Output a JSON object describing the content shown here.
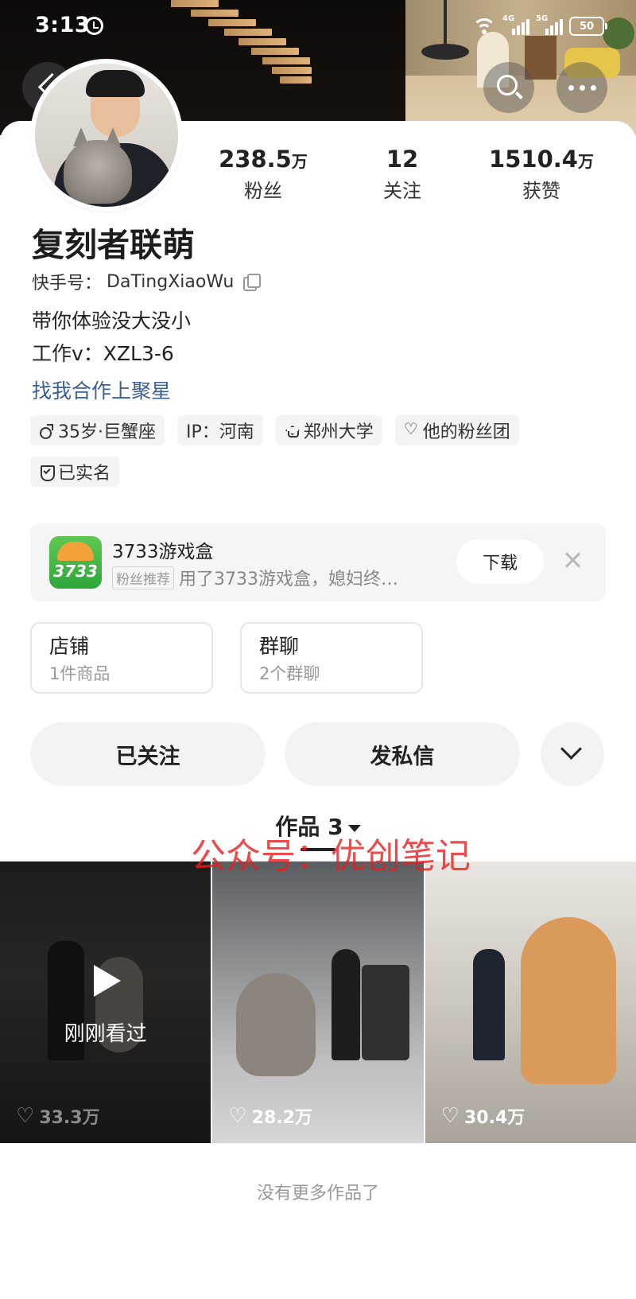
{
  "status_bar": {
    "time": "3:13",
    "net1": "4G",
    "net2": "5G",
    "battery": "50"
  },
  "header": {
    "icons": [
      "back-icon",
      "search-icon",
      "more-icon"
    ]
  },
  "profile": {
    "nickname": "复刻者联萌",
    "account_label": "快手号：",
    "account_id": "DaTingXiaoWu",
    "bio_line1": "带你体验没大没小",
    "bio_line2": "工作v：XZL3-6",
    "cooperation_link": "找我合作上聚星",
    "stats": [
      {
        "num": "238.5",
        "unit": "万",
        "label": "粉丝"
      },
      {
        "num": "12",
        "unit": "",
        "label": "关注"
      },
      {
        "num": "1510.4",
        "unit": "万",
        "label": "获赞"
      }
    ],
    "tags": [
      {
        "icon": "male-icon",
        "text": "35岁·巨蟹座"
      },
      {
        "icon": "",
        "text": "IP：河南"
      },
      {
        "icon": "cap-icon",
        "text": "郑州大学"
      },
      {
        "icon": "heart-icon",
        "text": "他的粉丝团"
      },
      {
        "icon": "shield-icon",
        "text": "已实名"
      }
    ]
  },
  "ad": {
    "logo_text": "3733",
    "title": "3733游戏盒",
    "badge": "粉丝推荐",
    "desc": "用了3733游戏盒，媳妇终…",
    "download": "下载"
  },
  "cards": [
    {
      "title": "店铺",
      "sub": "1件商品"
    },
    {
      "title": "群聊",
      "sub": "2个群聊"
    }
  ],
  "actions": {
    "follow": "已关注",
    "message": "发私信"
  },
  "works": {
    "tab_label": "作品 3",
    "items": [
      {
        "likes": "33.3万",
        "overlay": "刚刚看过"
      },
      {
        "likes": "28.2万",
        "overlay": ""
      },
      {
        "likes": "30.4万",
        "overlay": ""
      }
    ],
    "watermark": "公众号：优创笔记",
    "no_more": "没有更多作品了"
  },
  "colors": {
    "link": "#3a5f99",
    "chip_bg": "#f4f4f5",
    "button_bg": "#f3f3f4"
  }
}
